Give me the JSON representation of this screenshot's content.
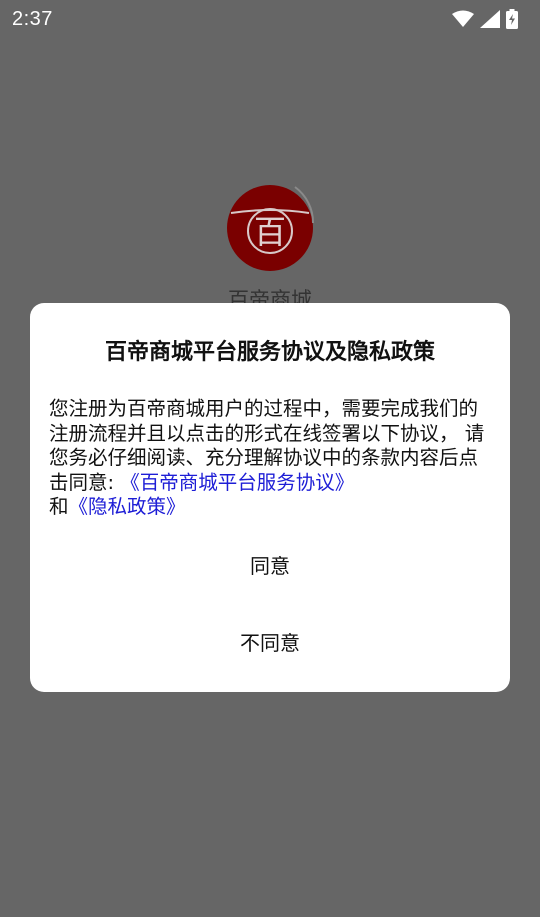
{
  "status_bar": {
    "time": "2:37",
    "icons": [
      "wifi-icon",
      "cellular-signal-icon",
      "battery-charging-icon"
    ]
  },
  "app": {
    "logo_char": "百",
    "name": "百帝商城",
    "logo_color": "#7a0000"
  },
  "dialog": {
    "title": "百帝商城平台服务协议及隐私政策",
    "body_text": "您注册为百帝商城用户的过程中，需要完成我们的注册流程并且以点击的形式在线签署以下协议， 请您务必仔细阅读、充分理解协议中的条款内容后点击同意: ",
    "link_service": "《百帝商城平台服务协议》",
    "conjunction": "和",
    "link_privacy": "《隐私政策》",
    "agree_label": "同意",
    "disagree_label": "不同意",
    "link_color": "#1d1dd6"
  }
}
